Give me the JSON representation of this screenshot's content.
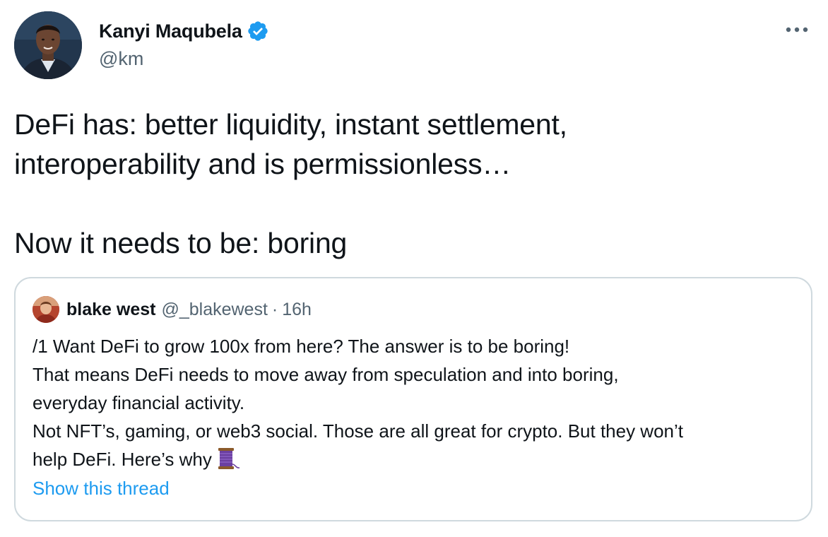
{
  "tweet": {
    "author": {
      "display_name": "Kanyi Maqubela",
      "handle": "@km",
      "verified": true,
      "verified_color": "#1d9bf0"
    },
    "text_lines": [
      "DeFi has: better liquidity, instant settlement,",
      "interoperability and is permissionless…",
      "Now it needs to be: boring"
    ]
  },
  "quoted_tweet": {
    "author": {
      "display_name": "blake west",
      "handle": "@_blakewest",
      "separator": "·",
      "time": "16h"
    },
    "text_lines": [
      "/1 Want DeFi to grow 100x from here? The answer is to be boring!",
      "That means DeFi needs to move away from speculation and into boring,",
      "everyday financial activity.",
      "Not NFT’s, gaming, or web3 social. Those are all great for crypto. But they won’t",
      "help DeFi. Here’s why"
    ],
    "thread_icon": "thread-spool-icon",
    "show_thread_label": "Show this thread"
  },
  "colors": {
    "text_primary": "#0f1419",
    "text_secondary": "#536471",
    "link": "#1d9bf0",
    "border": "#cfd9de"
  }
}
